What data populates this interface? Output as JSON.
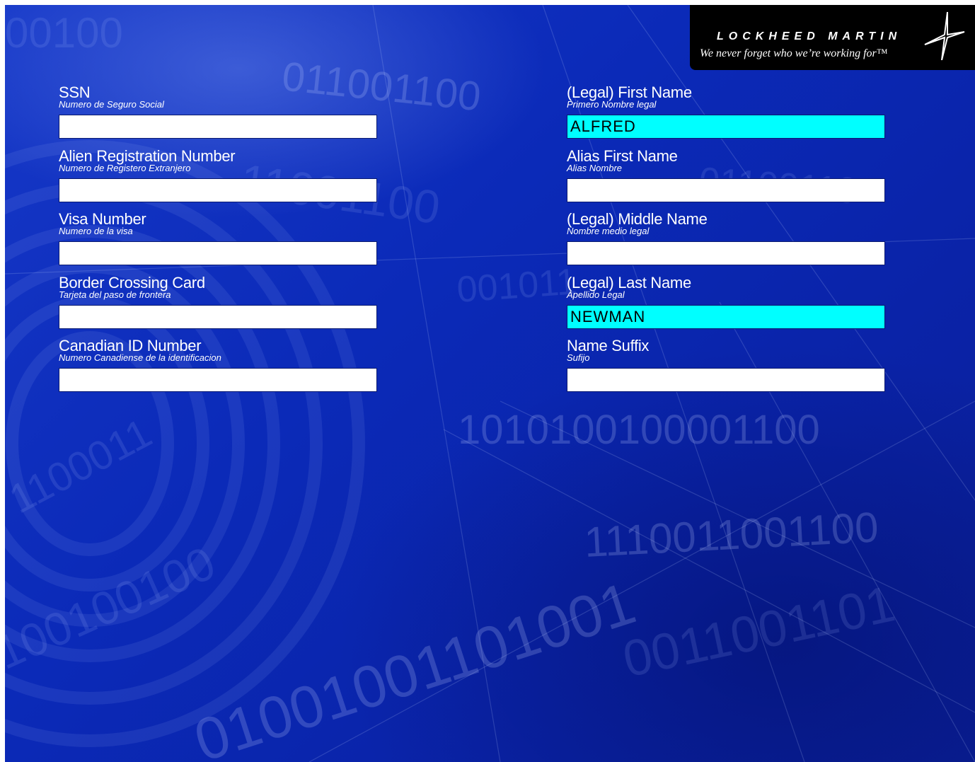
{
  "brand": {
    "name": "LOCKHEED MARTIN",
    "tagline": "We never forget who we’re working for™"
  },
  "left_fields": [
    {
      "label": "SSN",
      "sublabel": "Numero de Seguro Social",
      "value": ""
    },
    {
      "label": "Alien Registration Number",
      "sublabel": "Numero de Registero Extranjero",
      "value": ""
    },
    {
      "label": "Visa Number",
      "sublabel": "Numero de la visa",
      "value": ""
    },
    {
      "label": "Border Crossing Card",
      "sublabel": "Tarjeta del paso de frontera",
      "value": ""
    },
    {
      "label": "Canadian ID Number",
      "sublabel": "Numero Canadiense de la identificacion",
      "value": ""
    }
  ],
  "right_fields": [
    {
      "label": "(Legal) First Name",
      "sublabel": "Primero Nombre legal",
      "value": "ALFRED"
    },
    {
      "label": "Alias First Name",
      "sublabel": "Alias Nombre",
      "value": ""
    },
    {
      "label": "(Legal) Middle Name",
      "sublabel": "Nombre medio legal",
      "value": ""
    },
    {
      "label": "(Legal) Last Name",
      "sublabel": "Apellido Legal",
      "value": "NEWMAN"
    },
    {
      "label": "Name Suffix",
      "sublabel": "Sufijo",
      "value": ""
    }
  ],
  "colors": {
    "background": "#0b2ab8",
    "filled_field": "#00ffff",
    "empty_field": "#ffffff",
    "label_text": "#ffffff"
  }
}
